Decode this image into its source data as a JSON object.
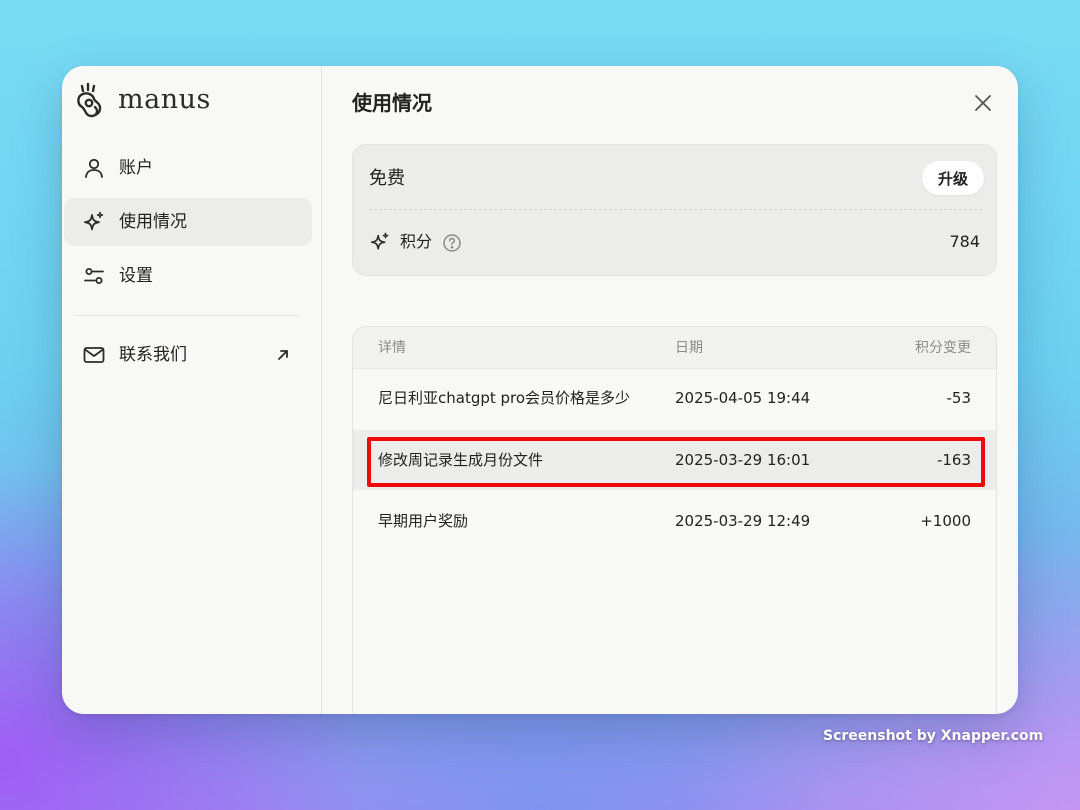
{
  "app": {
    "name": "manus"
  },
  "sidebar": {
    "items": [
      {
        "label": "账户",
        "icon": "user-icon"
      },
      {
        "label": "使用情况",
        "icon": "sparkle-icon",
        "active": true
      },
      {
        "label": "设置",
        "icon": "sliders-icon"
      },
      {
        "label": "联系我们",
        "icon": "mail-icon",
        "trailing_icon": "arrow-up-right-icon"
      }
    ]
  },
  "main": {
    "title": "使用情况",
    "plan": {
      "name": "免费",
      "upgrade_label": "升级",
      "credits_label": "积分",
      "credits_value": "784"
    },
    "table": {
      "columns": [
        "详情",
        "日期",
        "积分变更"
      ],
      "rows": [
        {
          "detail": "尼日利亚chatgpt pro会员价格是多少",
          "date": "2025-04-05 19:44",
          "change": "-53"
        },
        {
          "detail": "修改周记录生成月份文件",
          "date": "2025-03-29 16:01",
          "change": "-163",
          "highlighted": true
        },
        {
          "detail": "早期用户奖励",
          "date": "2025-03-29 12:49",
          "change": "+1000"
        }
      ]
    }
  },
  "watermark": "Screenshot by Xnapper.com",
  "colors": {
    "highlight_border": "#ee0a0a",
    "active_item_bg": "#ececea",
    "window_bg": "#f8f8f7"
  }
}
